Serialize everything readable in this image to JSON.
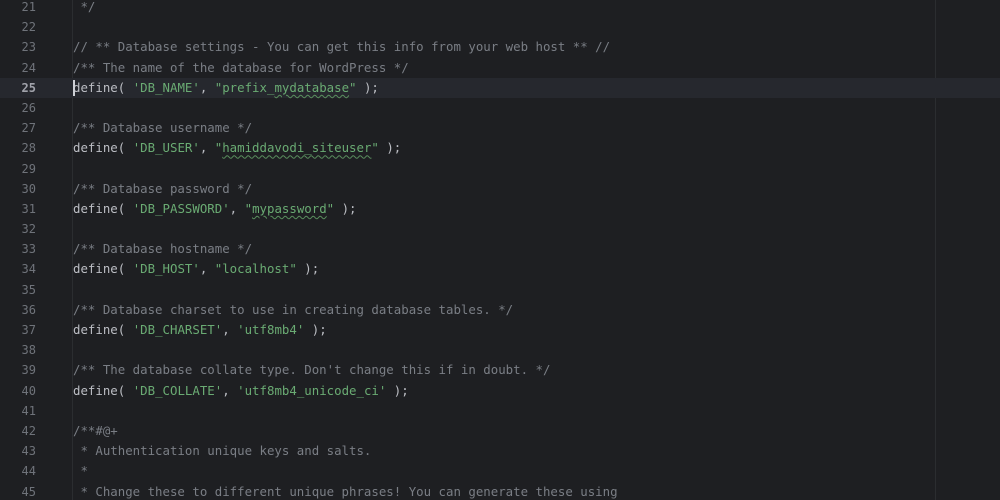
{
  "editor": {
    "current_line": "25",
    "lines": [
      {
        "n": "21",
        "tokens": [
          {
            "t": " */",
            "c": "tok-comment"
          }
        ]
      },
      {
        "n": "22",
        "tokens": []
      },
      {
        "n": "23",
        "tokens": [
          {
            "t": "// ** Database settings - You can get this info from your web host ** //",
            "c": "tok-comment"
          }
        ]
      },
      {
        "n": "24",
        "tokens": [
          {
            "t": "/** The name of the database for WordPress */",
            "c": "tok-comment"
          }
        ]
      },
      {
        "n": "25",
        "current": true,
        "tokens": [
          {
            "t": "define",
            "c": "tok-keyword"
          },
          {
            "t": "( ",
            "c": "tok-plain"
          },
          {
            "t": "'DB_NAME'",
            "c": "tok-string"
          },
          {
            "t": ", ",
            "c": "tok-plain"
          },
          {
            "t": "\"prefix_",
            "c": "tok-string"
          },
          {
            "t": "mydatabase",
            "c": "tok-string tok-typo"
          },
          {
            "t": "\"",
            "c": "tok-string"
          },
          {
            "t": " );",
            "c": "tok-plain"
          }
        ]
      },
      {
        "n": "26",
        "tokens": []
      },
      {
        "n": "27",
        "tokens": [
          {
            "t": "/** Database username */",
            "c": "tok-comment"
          }
        ]
      },
      {
        "n": "28",
        "tokens": [
          {
            "t": "define",
            "c": "tok-keyword"
          },
          {
            "t": "( ",
            "c": "tok-plain"
          },
          {
            "t": "'DB_USER'",
            "c": "tok-string"
          },
          {
            "t": ", ",
            "c": "tok-plain"
          },
          {
            "t": "\"",
            "c": "tok-string"
          },
          {
            "t": "hamiddavodi_siteuser",
            "c": "tok-string tok-typo"
          },
          {
            "t": "\"",
            "c": "tok-string"
          },
          {
            "t": " );",
            "c": "tok-plain"
          }
        ]
      },
      {
        "n": "29",
        "tokens": []
      },
      {
        "n": "30",
        "tokens": [
          {
            "t": "/** Database password */",
            "c": "tok-comment"
          }
        ]
      },
      {
        "n": "31",
        "tokens": [
          {
            "t": "define",
            "c": "tok-keyword"
          },
          {
            "t": "( ",
            "c": "tok-plain"
          },
          {
            "t": "'DB_PASSWORD'",
            "c": "tok-string"
          },
          {
            "t": ", ",
            "c": "tok-plain"
          },
          {
            "t": "\"",
            "c": "tok-string"
          },
          {
            "t": "mypassword",
            "c": "tok-string tok-typo"
          },
          {
            "t": "\"",
            "c": "tok-string"
          },
          {
            "t": " );",
            "c": "tok-plain"
          }
        ]
      },
      {
        "n": "32",
        "tokens": []
      },
      {
        "n": "33",
        "tokens": [
          {
            "t": "/** Database hostname */",
            "c": "tok-comment"
          }
        ]
      },
      {
        "n": "34",
        "tokens": [
          {
            "t": "define",
            "c": "tok-keyword"
          },
          {
            "t": "( ",
            "c": "tok-plain"
          },
          {
            "t": "'DB_HOST'",
            "c": "tok-string"
          },
          {
            "t": ", ",
            "c": "tok-plain"
          },
          {
            "t": "\"localhost\"",
            "c": "tok-string"
          },
          {
            "t": " );",
            "c": "tok-plain"
          }
        ]
      },
      {
        "n": "35",
        "tokens": []
      },
      {
        "n": "36",
        "tokens": [
          {
            "t": "/** Database charset to use in creating database tables. */",
            "c": "tok-comment"
          }
        ]
      },
      {
        "n": "37",
        "tokens": [
          {
            "t": "define",
            "c": "tok-keyword"
          },
          {
            "t": "( ",
            "c": "tok-plain"
          },
          {
            "t": "'DB_CHARSET'",
            "c": "tok-string"
          },
          {
            "t": ", ",
            "c": "tok-plain"
          },
          {
            "t": "'utf8mb4'",
            "c": "tok-string"
          },
          {
            "t": " );",
            "c": "tok-plain"
          }
        ]
      },
      {
        "n": "38",
        "tokens": []
      },
      {
        "n": "39",
        "tokens": [
          {
            "t": "/** The database collate type. Don't change this if in doubt. */",
            "c": "tok-comment"
          }
        ]
      },
      {
        "n": "40",
        "tokens": [
          {
            "t": "define",
            "c": "tok-keyword"
          },
          {
            "t": "( ",
            "c": "tok-plain"
          },
          {
            "t": "'DB_COLLATE'",
            "c": "tok-string"
          },
          {
            "t": ", ",
            "c": "tok-plain"
          },
          {
            "t": "'utf8mb4_unicode_ci'",
            "c": "tok-string"
          },
          {
            "t": " );",
            "c": "tok-plain"
          }
        ]
      },
      {
        "n": "41",
        "tokens": []
      },
      {
        "n": "42",
        "tokens": [
          {
            "t": "/**#@+",
            "c": "tok-comment"
          }
        ]
      },
      {
        "n": "43",
        "tokens": [
          {
            "t": " * Authentication unique keys and salts.",
            "c": "tok-comment"
          }
        ]
      },
      {
        "n": "44",
        "tokens": [
          {
            "t": " *",
            "c": "tok-comment"
          }
        ]
      },
      {
        "n": "45",
        "tokens": [
          {
            "t": " * Change these to different unique phrases! You can generate these using",
            "c": "tok-comment"
          }
        ]
      }
    ]
  },
  "colors": {
    "background": "#1e1f22",
    "current_line": "#26282e",
    "comment": "#7a7e85",
    "string": "#6aab73",
    "plain": "#bcbec4",
    "line_number": "#6f737a"
  }
}
